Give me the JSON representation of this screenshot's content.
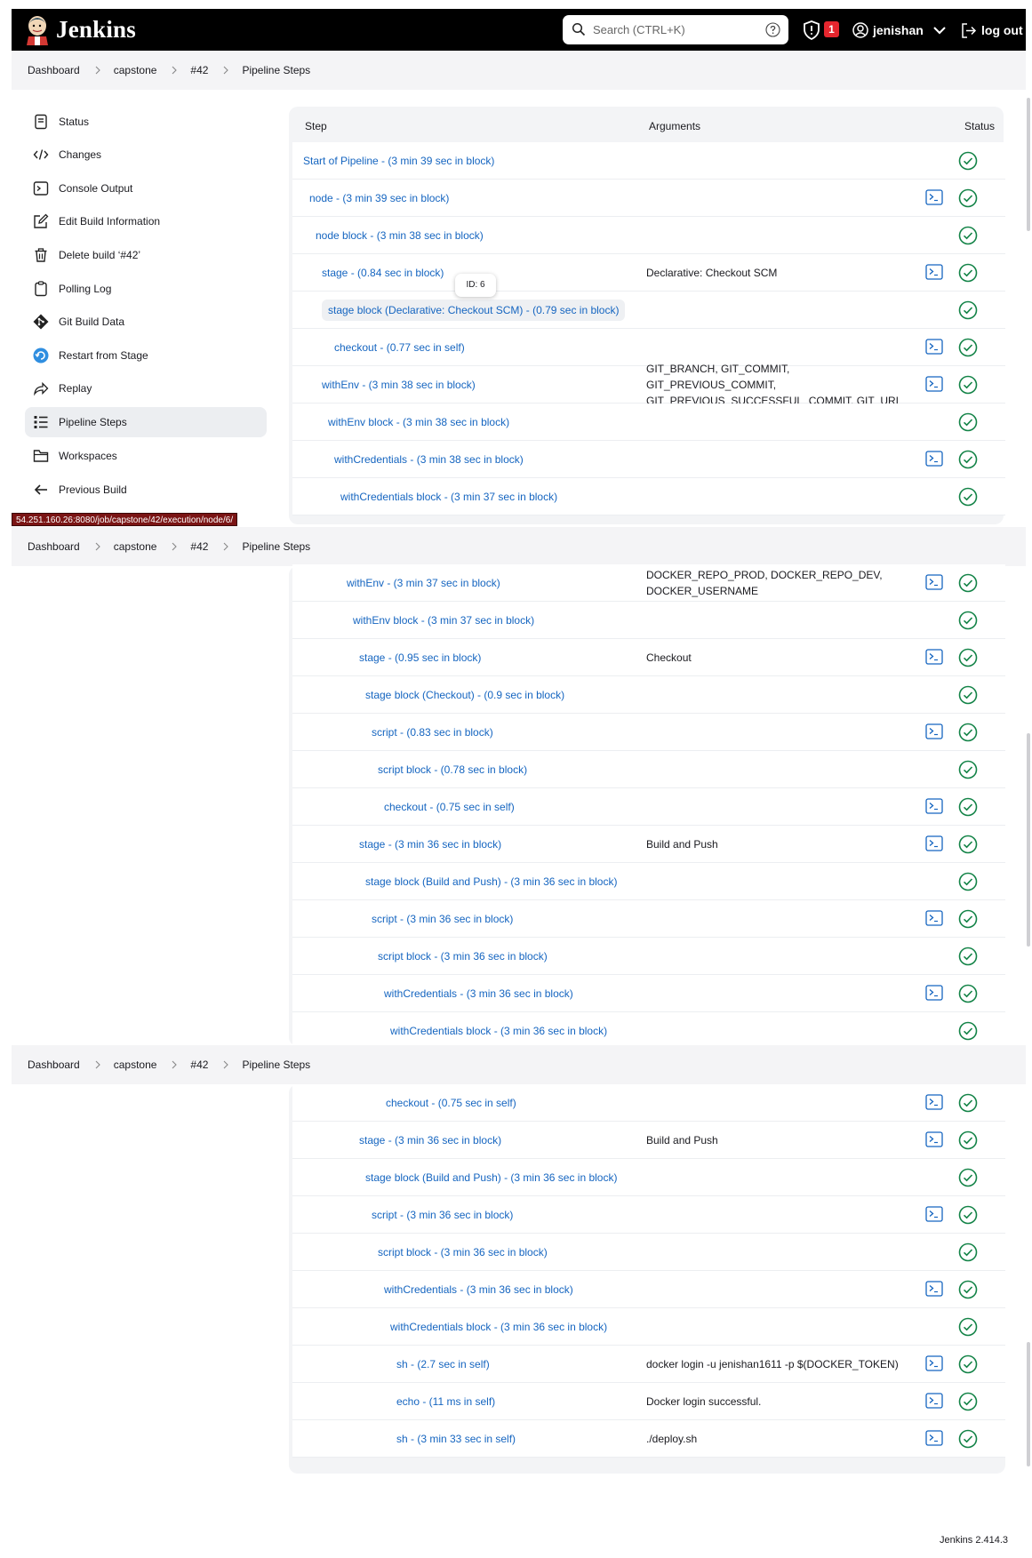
{
  "header": {
    "brand": "Jenkins",
    "search_placeholder": "Search (CTRL+K)",
    "security_badge": "1",
    "username": "jenishan",
    "logout": "log out"
  },
  "breadcrumb": [
    "Dashboard",
    "capstone",
    "#42",
    "Pipeline Steps"
  ],
  "sidebar": {
    "items": [
      {
        "label": "Status",
        "icon": "status-icon"
      },
      {
        "label": "Changes",
        "icon": "code-icon"
      },
      {
        "label": "Console Output",
        "icon": "terminal-icon"
      },
      {
        "label": "Edit Build Information",
        "icon": "edit-icon"
      },
      {
        "label": "Delete build ‘#42’",
        "icon": "trash-icon"
      },
      {
        "label": "Polling Log",
        "icon": "clipboard-icon"
      },
      {
        "label": "Git Build Data",
        "icon": "git-icon"
      },
      {
        "label": "Restart from Stage",
        "icon": "restart-icon"
      },
      {
        "label": "Replay",
        "icon": "replay-icon"
      },
      {
        "label": "Pipeline Steps",
        "icon": "list-icon",
        "active": true
      },
      {
        "label": "Workspaces",
        "icon": "folder-icon"
      },
      {
        "label": "Previous Build",
        "icon": "arrow-left-icon"
      }
    ]
  },
  "status_url": "54.251.160.26:8080/job/capstone/42/execution/node/6/",
  "table": {
    "headers": {
      "step": "Step",
      "arguments": "Arguments",
      "status": "Status"
    }
  },
  "tooltip": "ID: 6",
  "section1": [
    {
      "step": "Start of Pipeline - (3 min 39 sec in block)",
      "args": "",
      "console": false
    },
    {
      "step": "node - (3 min 39 sec in block)",
      "args": "",
      "console": true
    },
    {
      "step": "node block - (3 min 38 sec in block)",
      "args": "",
      "console": false
    },
    {
      "step": "stage - (0.84 sec in block)",
      "args": "Declarative: Checkout SCM",
      "console": true
    },
    {
      "step": "stage block (Declarative: Checkout SCM) - (0.79 sec in block)",
      "args": "",
      "console": false
    },
    {
      "step": "checkout - (0.77 sec in self)",
      "args": "",
      "console": true
    },
    {
      "step": "withEnv - (3 min 38 sec in block)",
      "args": "GIT_BRANCH, GIT_COMMIT, GIT_PREVIOUS_COMMIT, GIT_PREVIOUS_SUCCESSFUL_COMMIT, GIT_URL",
      "console": true
    },
    {
      "step": "withEnv block - (3 min 38 sec in block)",
      "args": "",
      "console": false
    },
    {
      "step": "withCredentials - (3 min 38 sec in block)",
      "args": "",
      "console": true
    },
    {
      "step": "withCredentials block - (3 min 37 sec in block)",
      "args": "",
      "console": false
    }
  ],
  "section2": [
    {
      "step": "withEnv - (3 min 37 sec in block)",
      "args": "DOCKER_REPO_PROD, DOCKER_REPO_DEV, DOCKER_USERNAME",
      "console": true
    },
    {
      "step": "withEnv block - (3 min 37 sec in block)",
      "args": "",
      "console": false
    },
    {
      "step": "stage - (0.95 sec in block)",
      "args": "Checkout",
      "console": true
    },
    {
      "step": "stage block (Checkout) - (0.9 sec in block)",
      "args": "",
      "console": false
    },
    {
      "step": "script - (0.83 sec in block)",
      "args": "",
      "console": true
    },
    {
      "step": "script block - (0.78 sec in block)",
      "args": "",
      "console": false
    },
    {
      "step": "checkout - (0.75 sec in self)",
      "args": "",
      "console": true
    },
    {
      "step": "stage - (3 min 36 sec in block)",
      "args": "Build and Push",
      "console": true
    },
    {
      "step": "stage block (Build and Push) - (3 min 36 sec in block)",
      "args": "",
      "console": false
    },
    {
      "step": "script - (3 min 36 sec in block)",
      "args": "",
      "console": true
    },
    {
      "step": "script block - (3 min 36 sec in block)",
      "args": "",
      "console": false
    },
    {
      "step": "withCredentials - (3 min 36 sec in block)",
      "args": "",
      "console": true
    },
    {
      "step": "withCredentials block - (3 min 36 sec in block)",
      "args": "",
      "console": false
    }
  ],
  "section3": [
    {
      "step": "checkout - (0.75 sec in self)",
      "args": "",
      "console": true
    },
    {
      "step": "stage - (3 min 36 sec in block)",
      "args": "Build and Push",
      "console": true
    },
    {
      "step": "stage block (Build and Push) - (3 min 36 sec in block)",
      "args": "",
      "console": false
    },
    {
      "step": "script - (3 min 36 sec in block)",
      "args": "",
      "console": true
    },
    {
      "step": "script block - (3 min 36 sec in block)",
      "args": "",
      "console": false
    },
    {
      "step": "withCredentials - (3 min 36 sec in block)",
      "args": "",
      "console": true
    },
    {
      "step": "withCredentials block - (3 min 36 sec in block)",
      "args": "",
      "console": false
    },
    {
      "step": "sh - (2.7 sec in self)",
      "args": "docker login -u jenishan1611 -p $(DOCKER_TOKEN)",
      "console": true
    },
    {
      "step": "echo - (11 ms in self)",
      "args": "Docker login successful.",
      "console": true
    },
    {
      "step": "sh - (3 min 33 sec in self)",
      "args": "./deploy.sh",
      "console": true
    }
  ],
  "footer": {
    "version": "Jenkins 2.414.3"
  },
  "colors": {
    "link": "#1565c0",
    "success": "#138347",
    "header_bg": "#000000",
    "badge": "#e5262e"
  }
}
